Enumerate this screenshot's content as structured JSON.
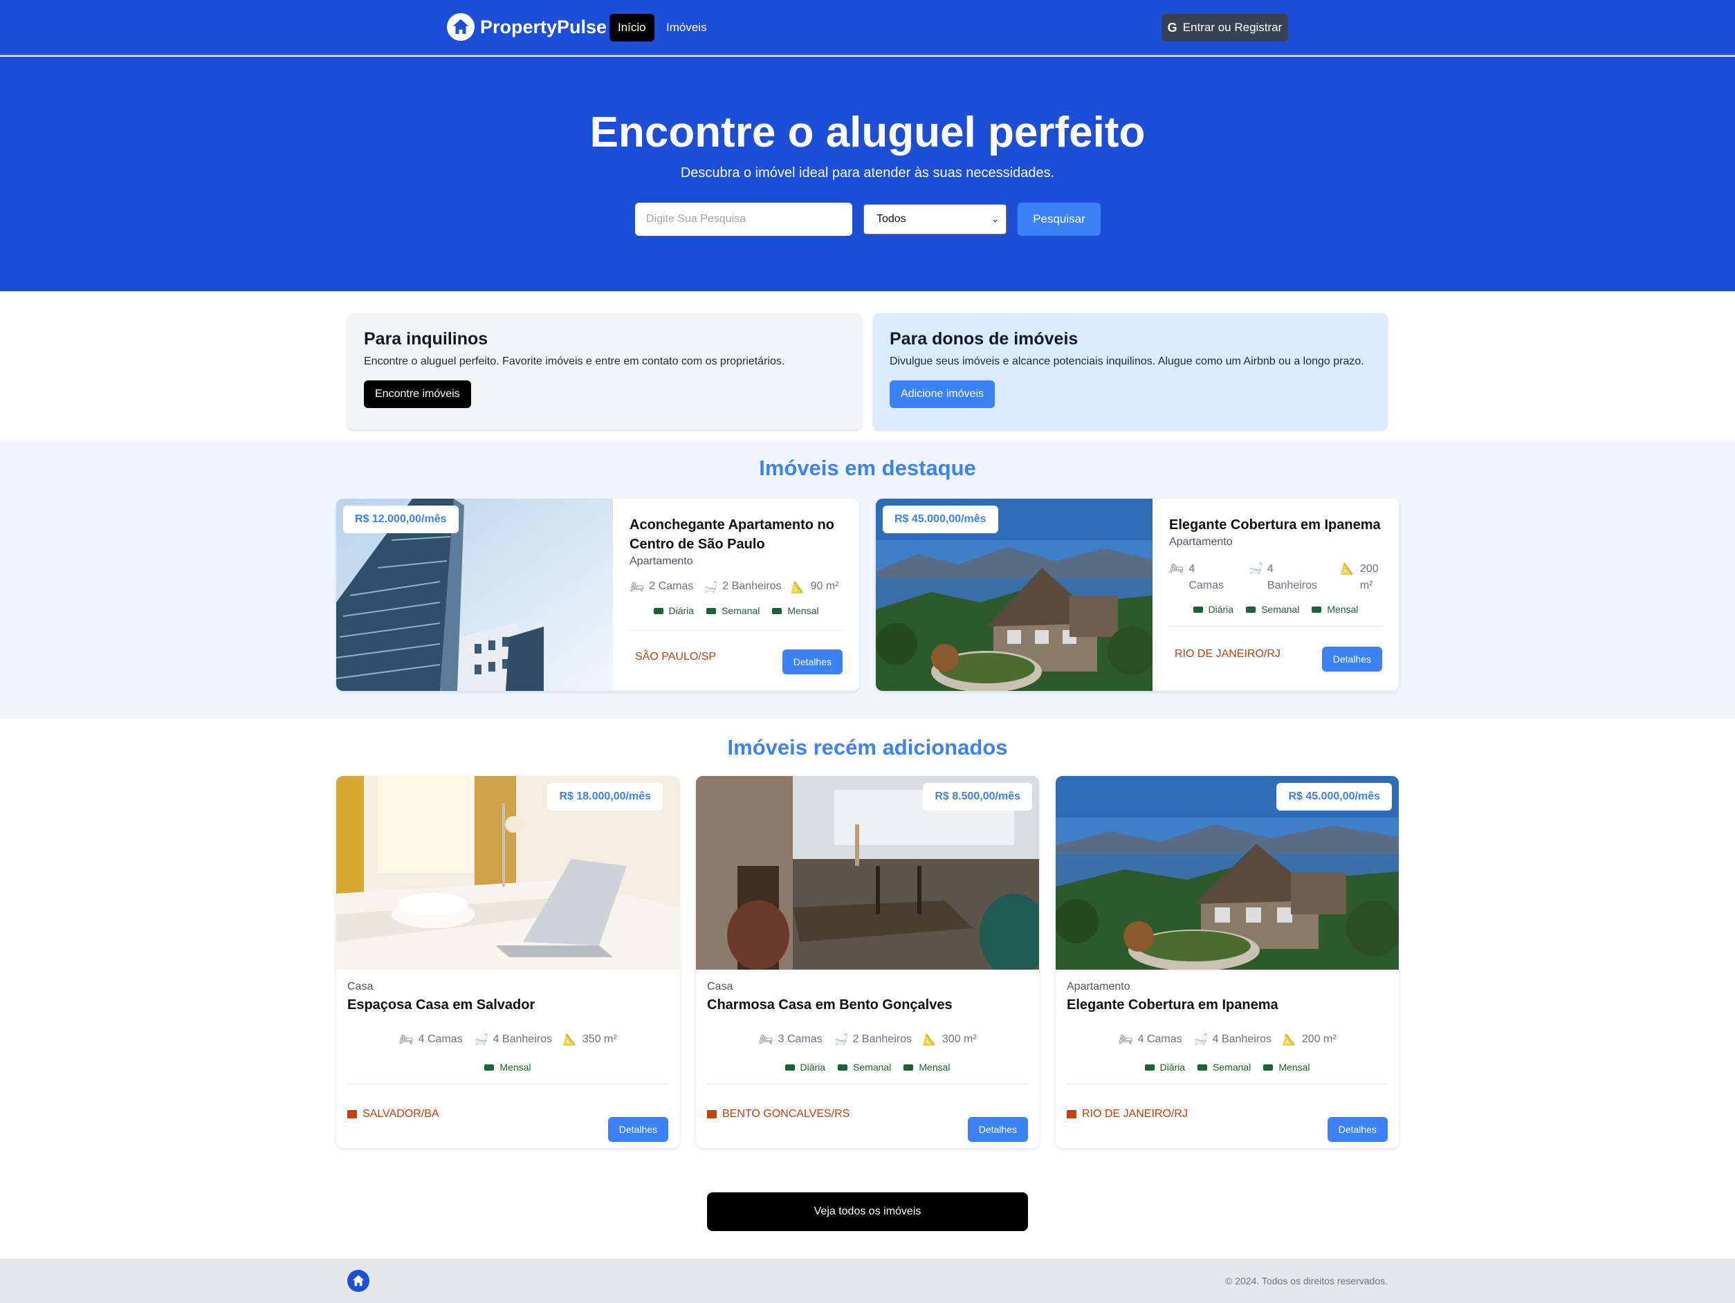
{
  "nav": {
    "brand": "PropertyPulse",
    "links": [
      "Início",
      "Imóveis"
    ],
    "login": "Entrar ou Registrar"
  },
  "hero": {
    "title": "Encontre o aluguel perfeito",
    "subtitle": "Descubra o imóvel ideal para atender às suas necessidades.",
    "search_placeholder": "Digite Sua Pesquisa",
    "type_selected": "Todos",
    "search_button": "Pesquisar"
  },
  "info_boxes": [
    {
      "title": "Para inquilinos",
      "text": "Encontre o aluguel perfeito. Favorite imóveis e entre em contato com os proprietários.",
      "button": "Encontre imóveis",
      "bg": "#f3f4f6",
      "button_bg": "#000000"
    },
    {
      "title": "Para donos de imóveis",
      "text": "Divulgue seus imóveis e alcance potenciais inquilinos. Alugue como um Airbnb ou a longo prazo.",
      "button": "Adicione imóveis",
      "bg": "#dbeafe",
      "button_bg": "#3b82f6"
    }
  ],
  "featured": {
    "title": "Imóveis em destaque",
    "items": [
      {
        "price": "R$ 12.000,00/mês",
        "title": "Aconchegante Apartamento no Centro de São Paulo",
        "type": "Apartamento",
        "beds": "2 Camas",
        "baths": "2 Banheiros",
        "area": "90 m²",
        "rates": [
          "Diária",
          "Semanal",
          "Mensal"
        ],
        "location": "SÃO PAULO/SP",
        "details": "Detalhes",
        "image": "building"
      },
      {
        "price": "R$ 45.000,00/mês",
        "title": "Elegante Cobertura em Ipanema",
        "type": "Apartamento",
        "beds": "4 Camas",
        "baths": "4 Banheiros",
        "area": "200 m²",
        "rates": [
          "Diária",
          "Semanal",
          "Mensal"
        ],
        "location": "RIO DE JANEIRO/RJ",
        "details": "Detalhes",
        "image": "lake-house"
      }
    ]
  },
  "recent": {
    "title": "Imóveis recém adicionados",
    "items": [
      {
        "price": "R$ 18.000,00/mês",
        "type": "Casa",
        "title": "Espaçosa Casa em Salvador",
        "beds": "4 Camas",
        "baths": "4 Banheiros",
        "area": "350 m²",
        "rates": [
          "Mensal"
        ],
        "location": "SALVADOR/BA",
        "details": "Detalhes",
        "image": "bedroom"
      },
      {
        "price": "R$ 8.500,00/mês",
        "type": "Casa",
        "title": "Charmosa Casa em Bento Gonçalves",
        "beds": "3 Camas",
        "baths": "2 Banheiros",
        "area": "300 m²",
        "rates": [
          "Diária",
          "Semanal",
          "Mensal"
        ],
        "location": "BENTO GONCALVES/RS",
        "details": "Detalhes",
        "image": "cafe"
      },
      {
        "price": "R$ 45.000,00/mês",
        "type": "Apartamento",
        "title": "Elegante Cobertura em Ipanema",
        "beds": "4 Camas",
        "baths": "4 Banheiros",
        "area": "200 m²",
        "rates": [
          "Diária",
          "Semanal",
          "Mensal"
        ],
        "location": "RIO DE JANEIRO/RJ",
        "details": "Detalhes",
        "image": "lake-house"
      }
    ]
  },
  "view_all": "Veja todos os imóveis",
  "footer": {
    "copyright": "© 2024. Todos os direitos reservados."
  },
  "colors": {
    "primary": "#1d4ed8",
    "accent": "#3b82f6",
    "location": "#c2410c",
    "rates": "#166534"
  }
}
